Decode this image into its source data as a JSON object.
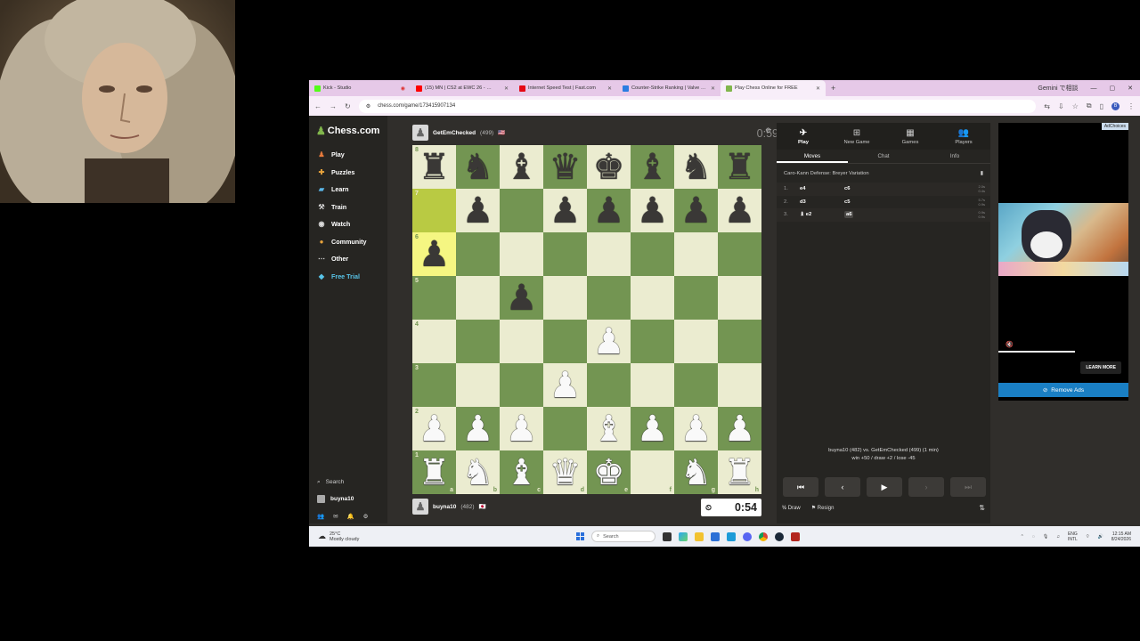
{
  "browser": {
    "tabs": [
      {
        "label": "Kick - Studio",
        "color": "#53fc18",
        "icon": "kick-icon"
      },
      {
        "label": "(15) MN | CS2 at EWC 26 - …",
        "color": "#ff0000",
        "icon": "youtube-icon"
      },
      {
        "label": "Internet Speed Test | Fast.com",
        "color": "#e50914",
        "icon": "fast-icon"
      },
      {
        "label": "Counter-Strike Ranking | Valve …",
        "color": "#2a7de1",
        "icon": "valve-icon"
      },
      {
        "label": "Play Chess Online for FREE",
        "color": "#81b64c",
        "icon": "chess-icon"
      }
    ],
    "gemini_label": "Gemini で相談",
    "url": "chess.com/game/173415907134"
  },
  "sidebar": {
    "logo": "Chess.com",
    "items": [
      {
        "label": "Play",
        "icon": "play-icon"
      },
      {
        "label": "Puzzles",
        "icon": "puzzle-icon"
      },
      {
        "label": "Learn",
        "icon": "learn-icon"
      },
      {
        "label": "Train",
        "icon": "train-icon"
      },
      {
        "label": "Watch",
        "icon": "watch-icon"
      },
      {
        "label": "Community",
        "icon": "community-icon"
      },
      {
        "label": "Other",
        "icon": "more-icon"
      },
      {
        "label": "Free Trial",
        "icon": "diamond-icon"
      }
    ],
    "search_label": "Search",
    "username": "buyna10"
  },
  "game": {
    "top_player": {
      "name": "GetEmChecked",
      "rating": "(499)",
      "flag": "🇺🇸"
    },
    "bottom_player": {
      "name": "buyna10",
      "rating": "(482)",
      "flag": "🇯🇵"
    },
    "top_clock": "0:59",
    "bottom_clock": "0:54",
    "board": [
      [
        "br",
        "bn",
        "bb",
        "bq",
        "bk",
        "bb",
        "bn",
        "br"
      ],
      [
        "",
        "bp",
        "",
        "bp",
        "bp",
        "bp",
        "bp",
        "bp"
      ],
      [
        "bp",
        "",
        "",
        "",
        "",
        "",
        "",
        ""
      ],
      [
        "",
        "",
        "bp",
        "",
        "",
        "",
        "",
        ""
      ],
      [
        "",
        "",
        "",
        "",
        "wp",
        "",
        "",
        ""
      ],
      [
        "",
        "",
        "",
        "wp",
        "",
        "",
        "",
        ""
      ],
      [
        "wp",
        "wp",
        "wp",
        "",
        "wb",
        "wp",
        "wp",
        "wp"
      ],
      [
        "wr",
        "wn",
        "wb",
        "wq",
        "wk",
        "",
        "wn",
        "wr"
      ]
    ],
    "ranks": [
      "8",
      "7",
      "6",
      "5",
      "4",
      "3",
      "2",
      "1"
    ],
    "files": [
      "a",
      "b",
      "c",
      "d",
      "e",
      "f",
      "g",
      "h"
    ]
  },
  "panel": {
    "tabs": [
      {
        "label": "Play",
        "icon": "play-icon"
      },
      {
        "label": "New Game",
        "icon": "new-game-icon"
      },
      {
        "label": "Games",
        "icon": "games-icon"
      },
      {
        "label": "Players",
        "icon": "players-icon"
      }
    ],
    "subtabs": [
      "Moves",
      "Chat",
      "Info"
    ],
    "opening": "Caro-Kann Defense: Breyer Variation",
    "moves": [
      {
        "num": "1.",
        "white": "e4",
        "black": "c6",
        "t1": "2.0s",
        "t2": "0.4s"
      },
      {
        "num": "2.",
        "white": "d3",
        "black": "c5",
        "t1": "5.7s",
        "t2": "0.9s"
      },
      {
        "num": "3.",
        "white": "♝ e2",
        "black": "a6",
        "t1": "0.9s",
        "t2": "0.9s"
      }
    ],
    "result_line1": "buyna10 (482) vs. GetEmChecked (499) (1 min)",
    "result_line2": "win +50 / draw +2 / lose -45",
    "draw_label": "Draw",
    "resign_label": "Resign"
  },
  "ad": {
    "adchoices": "AdChoices",
    "learn_more": "LEARN MORE",
    "remove_ads": "Remove Ads"
  },
  "taskbar": {
    "temp": "25°C",
    "weather": "Mostly cloudy",
    "search": "Search",
    "lang1": "ENG",
    "lang2": "INTL",
    "time": "12:15 AM",
    "date": "8/24/2026"
  }
}
